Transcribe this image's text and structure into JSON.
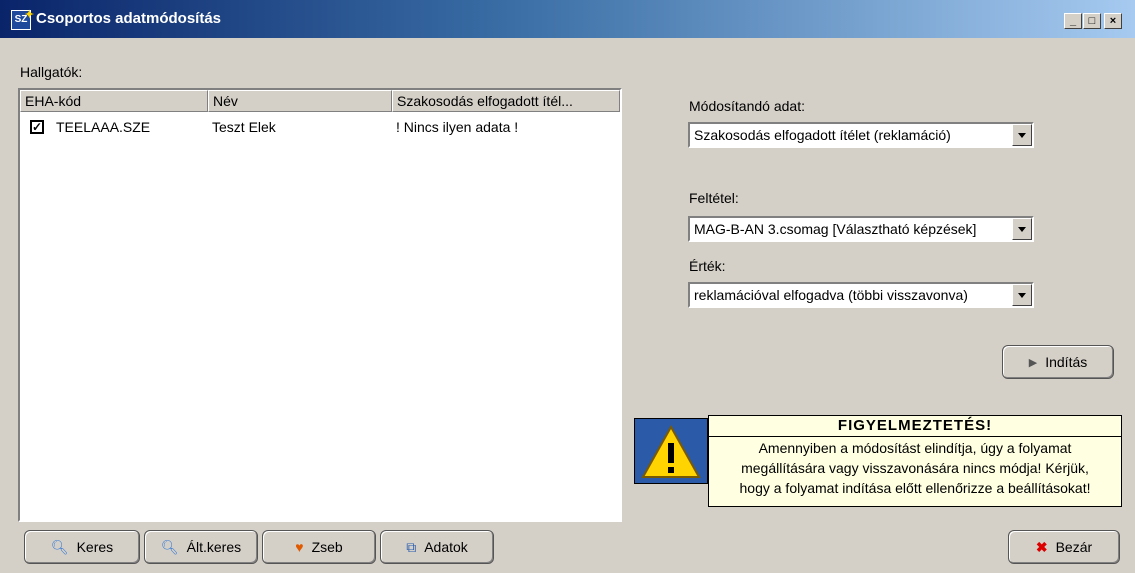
{
  "window": {
    "title": "Csoportos adatmódosítás",
    "app_icon_text": "SZ"
  },
  "students_label": "Hallgatók:",
  "columns": [
    "EHA-kód",
    "Név",
    "Szakosodás elfogadott ítél..."
  ],
  "rows": [
    {
      "checked": true,
      "code": "TEELAAA.SZE",
      "name": "Teszt Elek",
      "value": "! Nincs ilyen adata !"
    }
  ],
  "modify_field": {
    "label": "Módosítandó adat:",
    "value": "Szakosodás elfogadott ítélet (reklamáció)"
  },
  "condition": {
    "label": "Feltétel:",
    "value": "MAG-B-AN 3.csomag [Választható képzések]"
  },
  "value_field": {
    "label": "Érték:",
    "value": "reklamációval elfogadva (többi visszavonva)"
  },
  "start_button": "Indítás",
  "warning": {
    "title": "FIGYELMEZTETÉS!",
    "lines": [
      "Amennyiben a módosítást elindítja, úgy a folyamat",
      "megállítására vagy visszavonására nincs módja! Kérjük,",
      "hogy a folyamat indítása előtt ellenőrizze a beállításokat!"
    ]
  },
  "buttons": {
    "search": "Keres",
    "general_search": "Ált.keres",
    "pocket": "Zseb",
    "data": "Adatok",
    "close": "Bezár"
  },
  "colors": {
    "title_start": "#0a246a",
    "title_end": "#a6caf0",
    "warning_bg": "#ffffe1",
    "face": "#d4d0c8"
  }
}
